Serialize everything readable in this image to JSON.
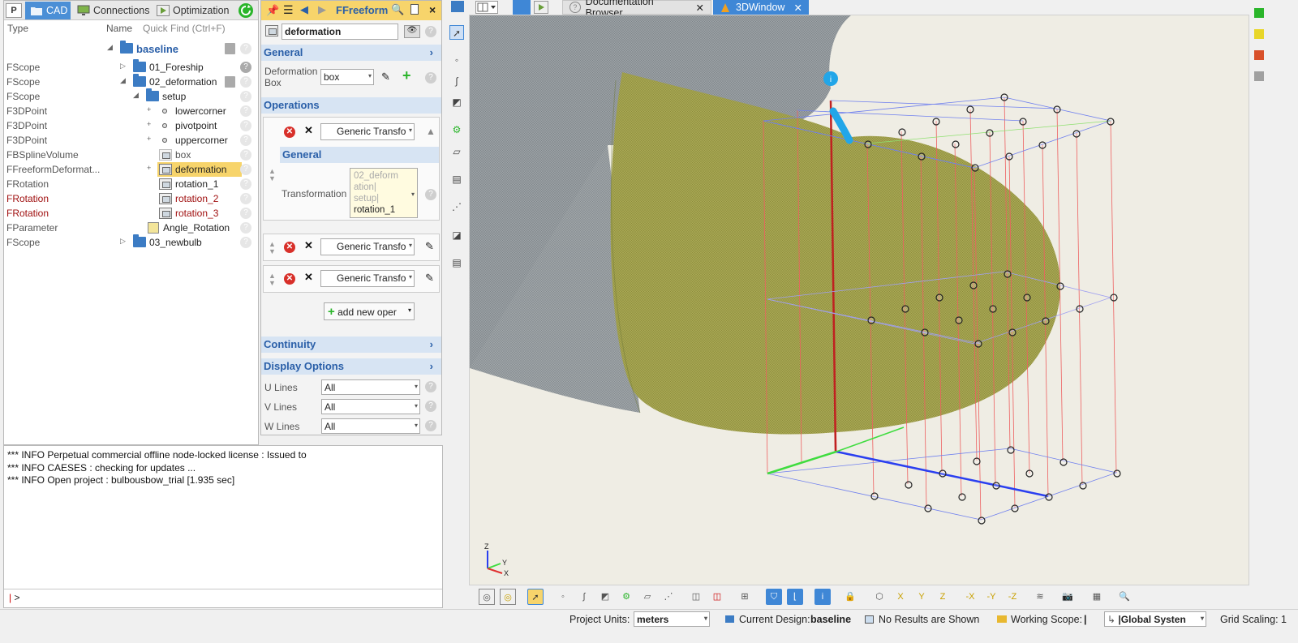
{
  "tree_tabs": [
    {
      "label": "P"
    },
    {
      "label": "CAD"
    },
    {
      "label": "Connections"
    },
    {
      "label": "Optimization"
    }
  ],
  "tree_header": {
    "type": "Type",
    "name": "Name",
    "quick_find": "Quick Find (Ctrl+F)"
  },
  "tree": {
    "root": "baseline",
    "rows": [
      {
        "type": "FScope",
        "label": "01_Foreship"
      },
      {
        "type": "FScope",
        "label": "02_deformation"
      },
      {
        "type": "FScope",
        "label": "setup"
      },
      {
        "type": "F3DPoint",
        "label": "lowercorner"
      },
      {
        "type": "F3DPoint",
        "label": "pivotpoint"
      },
      {
        "type": "F3DPoint",
        "label": "uppercorner"
      },
      {
        "type": "FBSplineVolume",
        "label": "box"
      },
      {
        "type": "FFreeformDeformat...",
        "label": "deformation"
      },
      {
        "type": "FRotation",
        "label": "rotation_1"
      },
      {
        "type": "FRotation",
        "label": "rotation_2"
      },
      {
        "type": "FRotation",
        "label": "rotation_3"
      },
      {
        "type": "FParameter",
        "label": "Angle_Rotation"
      },
      {
        "type": "FScope",
        "label": "03_newbulb"
      }
    ]
  },
  "editor": {
    "title": "FFreeform",
    "name_value": "deformation",
    "general_header": "General",
    "deformation_box_label": "Deformation Box",
    "deformation_box_value": "box",
    "operations_header": "Operations",
    "op1_type": "Generic Transfo",
    "op1_general": "General",
    "transformation_label": "Transformation",
    "transformation_lines": [
      "02_deform",
      "ation|",
      "setup|",
      "rotation_1"
    ],
    "op2_type": "Generic Transfo",
    "op3_type": "Generic Transfo",
    "add_new_label": "add new oper",
    "continuity_header": "Continuity",
    "display_header": "Display Options",
    "u_lines_label": "U Lines",
    "u_lines_value": "All",
    "v_lines_label": "V Lines",
    "v_lines_value": "All",
    "w_lines_label": "W Lines",
    "w_lines_value": "All"
  },
  "console": {
    "lines": [
      "*** INFO Perpetual commercial offline node-locked license : Issued to",
      "*** INFO CAESES : checking for updates ...",
      "*** INFO Open project : bulbousbow_trial [1.935 sec]"
    ],
    "prompt": ">"
  },
  "viewport_tabs": [
    {
      "label": "Documentation Browser"
    },
    {
      "label": "3DWindow"
    }
  ],
  "status": {
    "project_units_label": "Project Units:",
    "project_units_value": "meters",
    "current_design_label": "Current Design:",
    "current_design_value": "baseline",
    "results_text": "No Results are Shown",
    "working_scope_label": "Working Scope:",
    "working_scope_value": "|",
    "global_system": "|Global Systen",
    "grid_scaling": "Grid Scaling: 1"
  },
  "axis_labels": {
    "z": "Z",
    "y": "Y",
    "x": "X"
  },
  "colors": {
    "accent_blue": "#3f87d6",
    "title_yellow": "#f7d46b",
    "status_green": "#2ab52a",
    "status_yellow": "#e8d62a",
    "status_red": "#d8502a",
    "status_gray": "#a0a0a0"
  }
}
